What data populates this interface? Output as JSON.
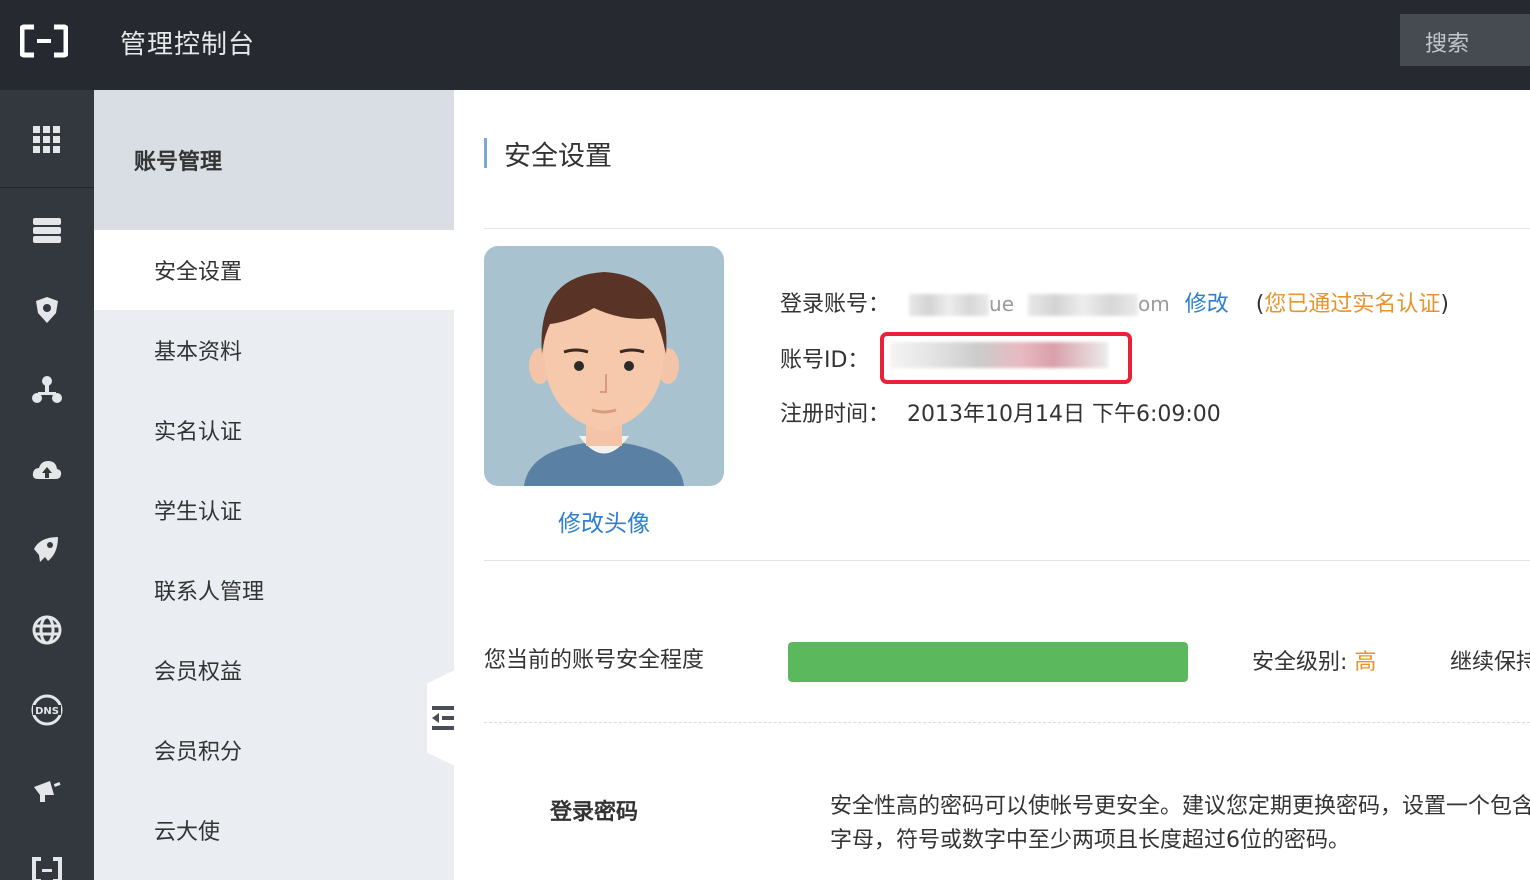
{
  "header": {
    "title": "管理控制台",
    "search_label": "搜索"
  },
  "rail": {
    "icons": [
      "grid-icon",
      "server-icon",
      "shield-icon",
      "network-icon",
      "cloud-icon",
      "rocket-icon",
      "globe-icon",
      "dns-icon",
      "megaphone-icon",
      "console-icon"
    ]
  },
  "submenu": {
    "title": "账号管理",
    "items": [
      {
        "label": "安全设置",
        "active": true
      },
      {
        "label": "基本资料"
      },
      {
        "label": "实名认证"
      },
      {
        "label": "学生认证"
      },
      {
        "label": "联系人管理"
      },
      {
        "label": "会员权益"
      },
      {
        "label": "会员积分"
      },
      {
        "label": "云大使"
      }
    ]
  },
  "main": {
    "page_title": "安全设置",
    "avatar_link": "修改头像",
    "login_label": "登录账号：",
    "login_masked_1": "ue",
    "login_masked_2": "om",
    "login_edit": "修改",
    "verify_open": "(",
    "verify_text": "您已通过实名认证",
    "verify_close": ")",
    "id_label": "账号ID：",
    "register_label": "注册时间：",
    "register_value": "2013年10月14日 下午6:09:00",
    "security_label": "您当前的账号安全程度",
    "security_percent": 100,
    "security_level_label": "安全级别: ",
    "security_level_value": "高",
    "security_continue": "继续保持",
    "password_title": "登录密码",
    "password_desc": "安全性高的密码可以使帐号更安全。建议您定期更换密码，设置一个包含字母，符号或数字中至少两项且长度超过6位的密码。"
  },
  "colors": {
    "topbar": "#262a30",
    "rail": "#33383f",
    "accent_link": "#2d7fd2",
    "warning": "#e6942e",
    "progress": "#5cb85c",
    "highlight": "#e9223a"
  }
}
